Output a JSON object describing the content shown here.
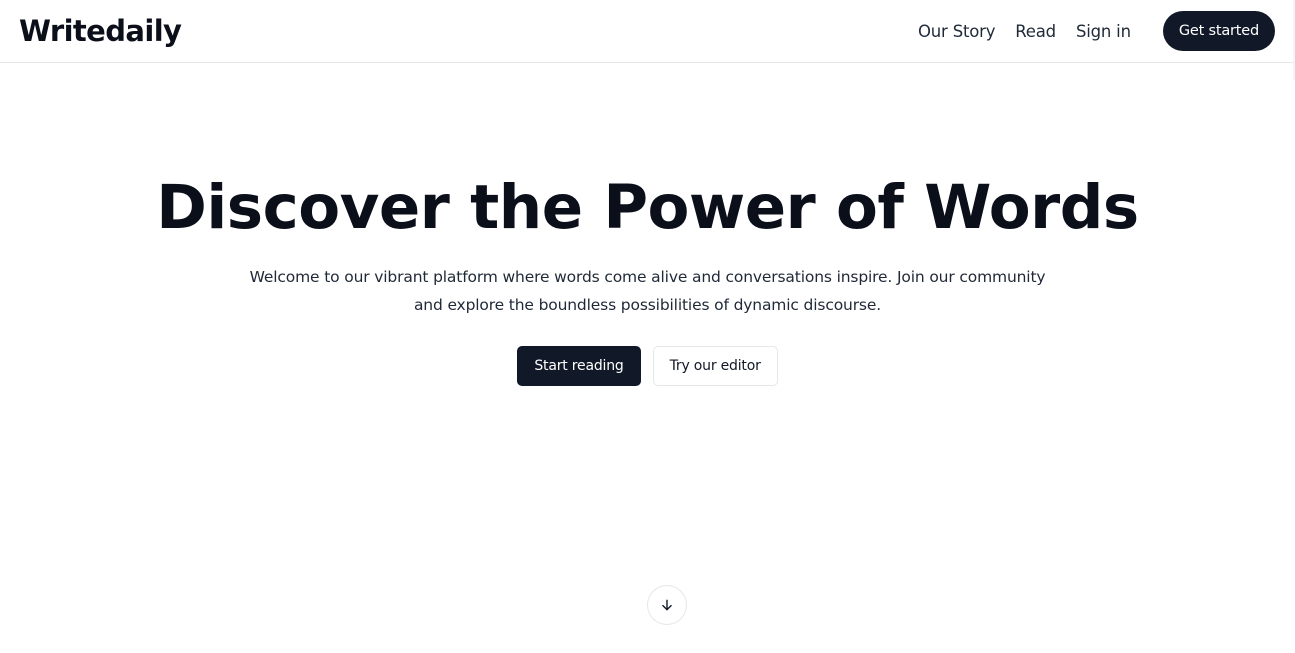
{
  "header": {
    "logo": "Writedaily",
    "nav": [
      {
        "label": "Our Story"
      },
      {
        "label": "Read"
      },
      {
        "label": "Sign in"
      }
    ],
    "cta_label": "Get started"
  },
  "hero": {
    "title": "Discover the Power of Words",
    "subtitle": "Welcome to our vibrant platform where words come alive and conversations inspire. Join our community and explore the boundless possibilities of dynamic discourse.",
    "primary_label": "Start reading",
    "secondary_label": "Try our editor"
  },
  "scroll": {
    "icon": "arrow-down-icon"
  },
  "colors": {
    "primary": "#111827",
    "border": "#e5e7eb",
    "text": "#0f172a"
  }
}
